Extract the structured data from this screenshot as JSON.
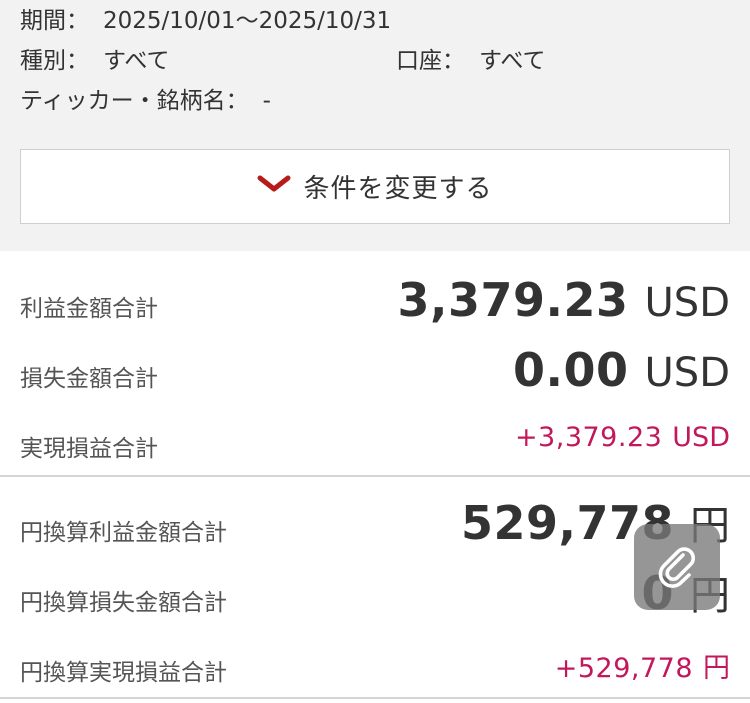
{
  "filters": {
    "period_label": "期間：",
    "period_value": "2025/10/01〜2025/10/31",
    "type_label": "種別：",
    "type_value": "すべて",
    "account_label": "口座：",
    "account_value": "すべて",
    "ticker_label": "ティッカー・銘柄名：",
    "ticker_value": "-"
  },
  "change_button": {
    "label": "条件を変更する",
    "icon": "chevron-down-icon"
  },
  "usd": {
    "profit_label": "利益金額合計",
    "profit_value": "3,379.23",
    "profit_unit": "USD",
    "loss_label": "損失金額合計",
    "loss_value": "0.00",
    "loss_unit": "USD",
    "realized_label": "実現損益合計",
    "realized_value": "+3,379.23",
    "realized_unit": "USD"
  },
  "jpy": {
    "profit_label": "円換算利益金額合計",
    "profit_value": "529,778",
    "profit_unit": "円",
    "loss_label": "円換算損失金額合計",
    "loss_value": "0",
    "loss_unit": "円",
    "realized_label": "円換算実現損益合計",
    "realized_value": "+529,778",
    "realized_unit": "円"
  },
  "floating_button": {
    "icon": "paperclip-icon"
  },
  "colors": {
    "accent_red": "#c2185b",
    "chevron_red": "#b71c1c",
    "panel_bg": "#f2f2f2"
  }
}
